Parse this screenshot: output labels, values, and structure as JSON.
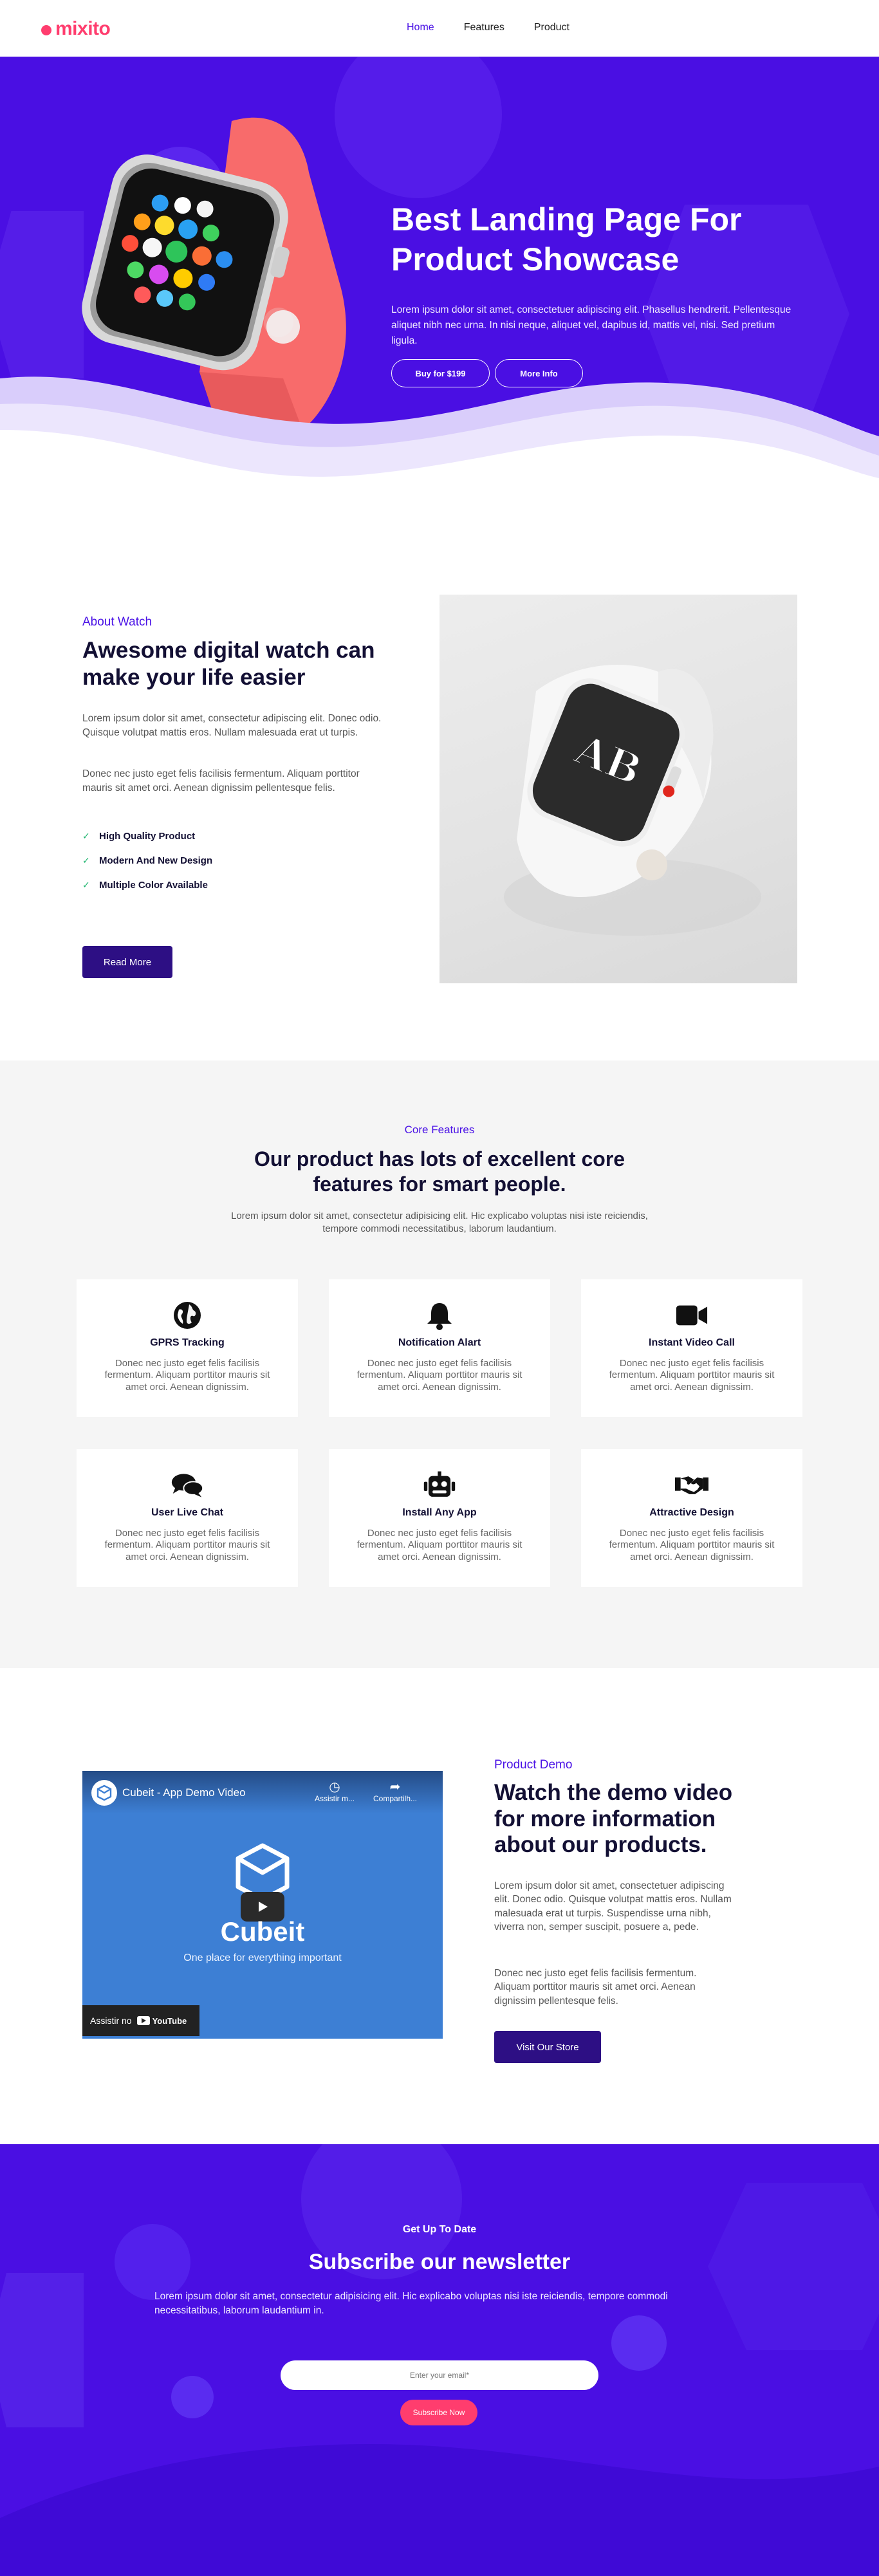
{
  "nav": {
    "logo": "mixito",
    "items": [
      "Home",
      "Features",
      "Product"
    ],
    "active": "Home"
  },
  "hero": {
    "title": "Best Landing Page For Product Showcase",
    "text": "Lorem ipsum dolor sit amet, consectetuer adipiscing elit. Phasellus hendrerit. Pellentesque aliquet nibh nec urna. In nisi neque, aliquet vel, dapibus id, mattis vel, nisi. Sed pretium ligula.",
    "buy_label": "Buy for $199",
    "info_label": "More Info"
  },
  "about": {
    "eyebrow": "About Watch",
    "title": "Awesome digital watch can make your life easier",
    "p1": "Lorem ipsum dolor sit amet, consectetur adipiscing elit. Donec odio. Quisque volutpat mattis eros. Nullam malesuada erat ut turpis.",
    "p2": "Donec nec justo eget felis facilisis fermentum. Aliquam porttitor mauris sit amet orci. Aenean dignissim pellentesque felis.",
    "checks": [
      "High Quality Product",
      "Modern And New Design",
      "Multiple Color Available"
    ],
    "button": "Read More"
  },
  "features": {
    "eyebrow": "Core Features",
    "title": "Our product has lots of excellent core features for smart people.",
    "sub": "Lorem ipsum dolor sit amet, consectetur adipisicing elit. Hic explicabo voluptas nisi iste reiciendis, tempore commodi necessitatibus, laborum laudantium.",
    "cards": [
      {
        "title": "GPRS Tracking",
        "icon": "globe-icon",
        "text": "Donec nec justo eget felis facilisis fermentum. Aliquam porttitor mauris sit amet orci. Aenean dignissim."
      },
      {
        "title": "Notification Alart",
        "icon": "bell-icon",
        "text": "Donec nec justo eget felis facilisis fermentum. Aliquam porttitor mauris sit amet orci. Aenean dignissim."
      },
      {
        "title": "Instant Video Call",
        "icon": "video-camera-icon",
        "text": "Donec nec justo eget felis facilisis fermentum. Aliquam porttitor mauris sit amet orci. Aenean dignissim."
      },
      {
        "title": "User Live Chat",
        "icon": "chat-icon",
        "text": "Donec nec justo eget felis facilisis fermentum. Aliquam porttitor mauris sit amet orci. Aenean dignissim."
      },
      {
        "title": "Install Any App",
        "icon": "robot-icon",
        "text": "Donec nec justo eget felis facilisis fermentum. Aliquam porttitor mauris sit amet orci. Aenean dignissim."
      },
      {
        "title": "Attractive Design",
        "icon": "handshake-icon",
        "text": "Donec nec justo eget felis facilisis fermentum. Aliquam porttitor mauris sit amet orci. Aenean dignissim."
      }
    ]
  },
  "demo": {
    "video": {
      "title": "Cubeit - App Demo Video",
      "watch_later": "Assistir m...",
      "share": "Compartilh...",
      "brand": "Cubeit",
      "tagline": "One place for everything important",
      "watch_on": "Assistir no",
      "youtube": "YouTube"
    },
    "eyebrow": "Product Demo",
    "title": "Watch the demo video for more information about our products.",
    "p1": "Lorem ipsum dolor sit amet, consectetuer adipiscing elit. Donec odio. Quisque volutpat mattis eros. Nullam malesuada erat ut turpis. Suspendisse urna nibh, viverra non, semper suscipit, posuere a, pede.",
    "p2": "Donec nec justo eget felis facilisis fermentum. Aliquam porttitor mauris sit amet orci. Aenean dignissim pellentesque felis.",
    "button": "Visit Our Store"
  },
  "newsletter": {
    "eyebrow": "Get Up To Date",
    "title": "Subscribe our newsletter",
    "text": "Lorem ipsum dolor sit amet, consectetur adipisicing elit. Hic explicabo voluptas nisi iste reiciendis, tempore commodi necessitatibus, laborum laudantium in.",
    "placeholder": "Enter your email*",
    "button": "Subscribe Now"
  },
  "colors": {
    "brand_purple": "#4a0fe3",
    "logo_pink": "#ff3d6e",
    "dark_button": "#2d0f84",
    "heading": "#131034"
  }
}
